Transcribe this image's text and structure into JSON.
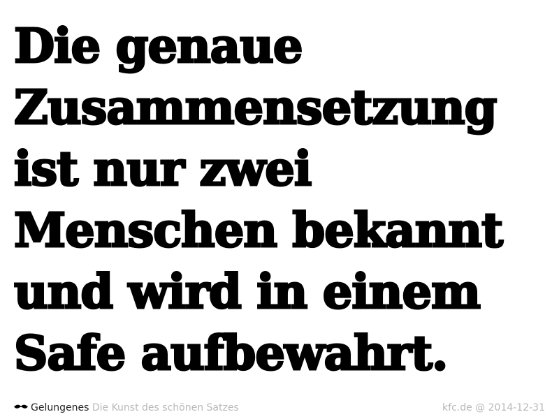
{
  "slide": {
    "headline_lines": [
      "Die genaue",
      "Zusammensetzung",
      "ist nur zwei",
      "Menschen bekannt",
      "und wird in einem",
      "Safe aufbewahrt."
    ]
  },
  "footer": {
    "logo_icon": "mustache-icon",
    "brand": "Gelungenes",
    "tagline": "Die Kunst des schönen Satzes",
    "credit": "kfc.de @ 2014-12-31"
  },
  "colors": {
    "text": "#000000",
    "muted": "#b8b8b8",
    "background": "#ffffff"
  }
}
